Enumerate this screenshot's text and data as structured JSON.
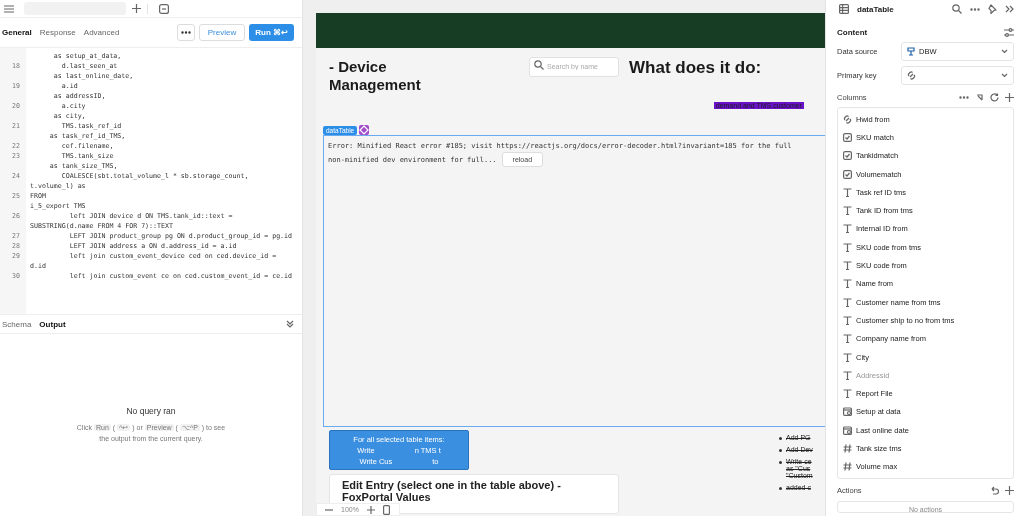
{
  "query_panel": {
    "tabs": [
      {
        "label": "General",
        "selected": true
      },
      {
        "label": "Response",
        "selected": false
      },
      {
        "label": "Advanced",
        "selected": false
      }
    ],
    "preview_button": "Preview",
    "run_button": "Run",
    "run_shortcut": "⌘↩",
    "code": [
      {
        "text": "      as setup_at_data,"
      },
      {
        "n": "18",
        "text": "        d.last_seen_at"
      },
      {
        "text": "      as last_online_date,"
      },
      {
        "n": "19",
        "text": "        a.id"
      },
      {
        "text": "      as addressID,"
      },
      {
        "n": "20",
        "text": "        a.city"
      },
      {
        "text": "      as city,"
      },
      {
        "n": "21",
        "text": "        TMS.task_ref_id"
      },
      {
        "text": "     as task_ref_id_TMS,"
      },
      {
        "n": "22",
        "text": "        cef.filename,"
      },
      {
        "n": "23",
        "text": "        TMS.tank_size"
      },
      {
        "text": "     as tank_size_TMS,"
      },
      {
        "n": "24",
        "text": "        COALESCE(sbt.total_volume_l * sb.storage_count, t.volume_l) as"
      },
      {
        "n": "25",
        "text": "FROM"
      },
      {
        "text": "i_5_export TMS"
      },
      {
        "n": "26",
        "text": "          left JOIN device d ON TMS.tank_id::text = SUBSTRING(d.name FROM 4 FOR 7)::TEXT"
      },
      {
        "n": "27",
        "text": "          LEFT JOIN product_group pg ON d.product_group_id = pg.id"
      },
      {
        "n": "28",
        "text": "          LEFT JOIN address a ON d.address_id = a.id"
      },
      {
        "n": "29",
        "text": "          left join custom_event_device ced on ced.device_id = d.id"
      },
      {
        "n": "30",
        "text": "          left join custom_event ce on ced.custom_event_id = ce.id"
      }
    ],
    "bottom_tabs": [
      {
        "label": "Schema",
        "selected": false
      },
      {
        "label": "Output",
        "selected": true
      }
    ],
    "output": {
      "title": "No query ran",
      "hint": [
        {
          "kind": "text",
          "text": "Click"
        },
        {
          "kind": "key",
          "text": "Run"
        },
        {
          "kind": "text",
          "text": "("
        },
        {
          "kind": "key",
          "text": "^↩"
        },
        {
          "kind": "text",
          "text": ") or"
        },
        {
          "kind": "key",
          "text": "Preview"
        },
        {
          "kind": "text",
          "text": "("
        },
        {
          "kind": "key",
          "text": "⌥^P"
        },
        {
          "kind": "text",
          "text": ") to see"
        },
        {
          "kind": "text",
          "text": "the output from the current query."
        }
      ]
    }
  },
  "canvas": {
    "title": "- Device Management",
    "search": {
      "placeholder": "Search by name"
    },
    "info_title": "What does it do:",
    "info_fragment": "demand and TMS.customer",
    "component_tag": "dataTable",
    "error": {
      "message": "Error: Minified React error #185; visit https://reactjs.org/docs/error-decoder.html?invariant=185 for the full",
      "message_2": "non-minified dev environment for full...",
      "reload": "reload"
    },
    "bulk_button": [
      [
        "For all selected table items:"
      ],
      [
        "Write",
        "n TMS t"
      ],
      [
        "Write Cus",
        "to"
      ]
    ],
    "notes": [
      {
        "text": "Add PG",
        "struck": true
      },
      {
        "text": "Add Dev",
        "struck": true
      },
      {
        "text": "Write ce",
        "struck": true,
        "more": [
          "as \"Cus",
          "\"Custom"
        ]
      },
      {
        "text": "added c",
        "struck": true
      }
    ],
    "edit_title": "Edit Entry (select one in the table above) - FoxPortal Values",
    "zoom": "100%"
  },
  "inspector": {
    "title": "dataTable",
    "section": "Content",
    "data_source": {
      "label": "Data source",
      "value": "DBW"
    },
    "primary_key": {
      "label": "Primary key"
    },
    "columns_label": "Columns",
    "columns": [
      {
        "kind": "link",
        "label": "Hwid from",
        "disabled": false
      },
      {
        "kind": "bool",
        "label": "SKU match",
        "disabled": false
      },
      {
        "kind": "bool",
        "label": "Tankidmatch",
        "disabled": false
      },
      {
        "kind": "bool",
        "label": "Volumematch",
        "disabled": false
      },
      {
        "kind": "text",
        "label": "Task ref ID tms",
        "disabled": false
      },
      {
        "kind": "text",
        "label": "Tank ID from tms",
        "disabled": false
      },
      {
        "kind": "text",
        "label": "Internal ID from",
        "disabled": false
      },
      {
        "kind": "text",
        "label": "SKU code from tms",
        "disabled": false
      },
      {
        "kind": "text",
        "label": "SKU code from",
        "disabled": false
      },
      {
        "kind": "text",
        "label": "Name from",
        "disabled": false
      },
      {
        "kind": "text",
        "label": "Customer name from tms",
        "disabled": false
      },
      {
        "kind": "text",
        "label": "Customer ship to no from tms",
        "disabled": false
      },
      {
        "kind": "text",
        "label": "Company name from",
        "disabled": false
      },
      {
        "kind": "text",
        "label": "City",
        "disabled": false
      },
      {
        "kind": "text",
        "label": "Addressid",
        "disabled": true
      },
      {
        "kind": "text",
        "label": "Report File",
        "disabled": false
      },
      {
        "kind": "date",
        "label": "Setup at data",
        "disabled": false
      },
      {
        "kind": "date",
        "label": "Last online date",
        "disabled": false
      },
      {
        "kind": "number",
        "label": "Tank size tms",
        "disabled": false
      },
      {
        "kind": "number",
        "label": "Volume max",
        "disabled": false
      }
    ],
    "actions_label": "Actions",
    "actions_empty": "No actions"
  }
}
